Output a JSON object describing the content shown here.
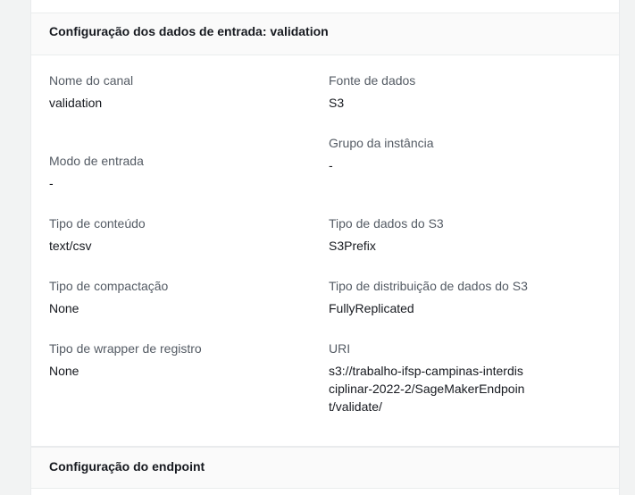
{
  "section_input": {
    "title": "Configuração dos dados de entrada: validation",
    "fields": {
      "channel_name": {
        "label": "Nome do canal",
        "value": "validation"
      },
      "data_source": {
        "label": "Fonte de dados",
        "value": "S3"
      },
      "instance_group": {
        "label": "Grupo da instância",
        "value": "-"
      },
      "input_mode": {
        "label": "Modo de entrada",
        "value": "-"
      },
      "content_type": {
        "label": "Tipo de conteúdo",
        "value": "text/csv"
      },
      "s3_data_type": {
        "label": "Tipo de dados do S3",
        "value": "S3Prefix"
      },
      "compression_type": {
        "label": "Tipo de compactação",
        "value": "None"
      },
      "s3_distribution_type": {
        "label": "Tipo de distribuição de dados do S3",
        "value": "FullyReplicated"
      },
      "record_wrapper_type": {
        "label": "Tipo de wrapper de registro",
        "value": "None"
      },
      "uri": {
        "label": "URI",
        "value": "s3://trabalho-ifsp-campinas-interdisciplinar-2022-2/SageMakerEndpoint/validate/"
      }
    }
  },
  "section_endpoint": {
    "title": "Configuração do endpoint"
  }
}
